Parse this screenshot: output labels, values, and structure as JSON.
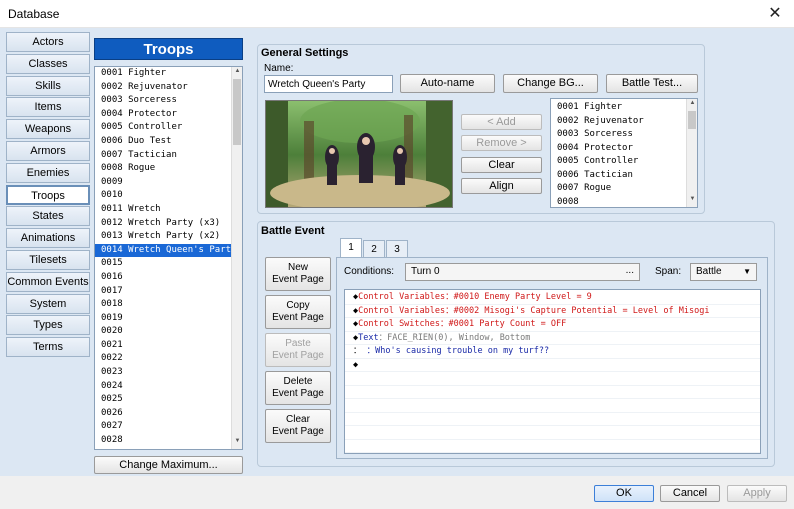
{
  "window": {
    "title": "Database",
    "close_glyph": "✕"
  },
  "tabs": [
    "Actors",
    "Classes",
    "Skills",
    "Items",
    "Weapons",
    "Armors",
    "Enemies",
    "Troops",
    "States",
    "Animations",
    "Tilesets",
    "Common Events",
    "System",
    "Types",
    "Terms"
  ],
  "active_tab": "Troops",
  "troops": {
    "header": "Troops",
    "items": [
      "0001 Fighter",
      "0002 Rejuvenator",
      "0003 Sorceress",
      "0004 Protector",
      "0005 Controller",
      "0006 Duo Test",
      "0007 Tactician",
      "0008 Rogue",
      "0009",
      "0010",
      "0011 Wretch",
      "0012 Wretch Party (x3)",
      "0013 Wretch Party (x2)",
      "0014 Wretch Queen's Party",
      "0015",
      "0016",
      "0017",
      "0018",
      "0019",
      "0020",
      "0021",
      "0022",
      "0023",
      "0024",
      "0025",
      "0026",
      "0027",
      "0028"
    ],
    "selected_index": 13,
    "change_max_label": "Change Maximum..."
  },
  "general": {
    "title": "General Settings",
    "name_label": "Name:",
    "name_value": "Wretch Queen's Party",
    "autoname": "Auto-name",
    "change_bg": "Change BG...",
    "battle_test": "Battle Test...",
    "add": "< Add",
    "remove": "Remove >",
    "clear": "Clear",
    "align": "Align",
    "enemies": [
      "0001 Fighter",
      "0002 Rejuvenator",
      "0003 Sorceress",
      "0004 Protector",
      "0005 Controller",
      "0006 Tactician",
      "0007 Rogue",
      "0008"
    ]
  },
  "battle_event": {
    "title": "Battle Event",
    "page_tabs": [
      "1",
      "2",
      "3"
    ],
    "new_page": [
      "New",
      "Event Page"
    ],
    "copy_page": [
      "Copy",
      "Event Page"
    ],
    "paste_page": [
      "Paste",
      "Event Page"
    ],
    "delete_page": [
      "Delete",
      "Event Page"
    ],
    "clear_page": [
      "Clear",
      "Event Page"
    ],
    "conditions_label": "Conditions:",
    "conditions_value": "Turn 0",
    "conditions_more": "...",
    "span_label": "Span:",
    "span_value": "Battle",
    "commands": [
      {
        "mark": "◆",
        "parts": [
          {
            "t": "Control Variables：#0010 Enemy Party Level = 9",
            "c": "red"
          }
        ]
      },
      {
        "mark": "◆",
        "parts": [
          {
            "t": "Control Variables：#0002 Misogi's Capture Potential = Level of Misogi",
            "c": "red"
          }
        ]
      },
      {
        "mark": "◆",
        "parts": [
          {
            "t": "Control Switches：#0001 Party Count = OFF",
            "c": "red"
          }
        ]
      },
      {
        "mark": "◆",
        "parts": [
          {
            "t": "Text",
            "c": "blue"
          },
          {
            "t": "：FACE_RIEN(0), Window, Bottom",
            "c": "gray"
          }
        ]
      },
      {
        "mark": "：",
        "parts": [
          {
            "t": "    ：Who's causing trouble on my turf??",
            "c": "blue"
          }
        ]
      },
      {
        "mark": "◆",
        "parts": []
      }
    ]
  },
  "footer": {
    "ok": "OK",
    "cancel": "Cancel",
    "apply": "Apply"
  },
  "colors": {
    "accent": "#0f5cbf",
    "selection": "#1a68d6",
    "command_red": "#d01818",
    "command_blue": "#1a2aa8"
  }
}
